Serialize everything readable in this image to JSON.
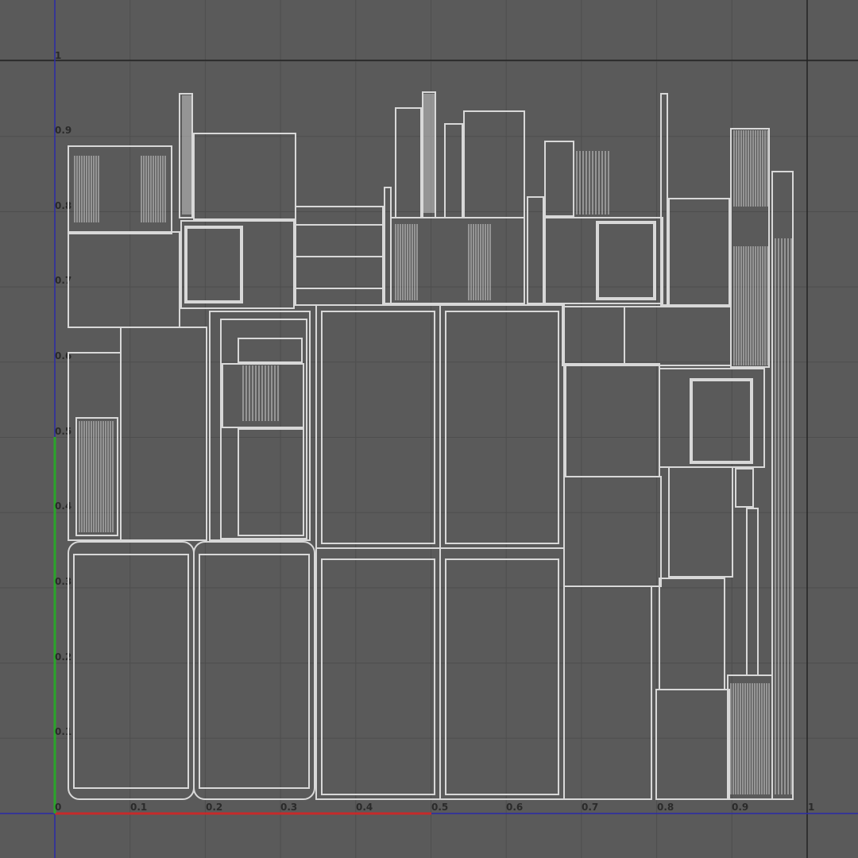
{
  "editor": {
    "type": "uv-texture-editor",
    "background": "#5a5a5a",
    "grid_color": "#4e4e4e",
    "border_color": "#222222",
    "wire_color": "#d8d8d8",
    "u_axis_color": "#c62a2a",
    "v_axis_color": "#2aa52a",
    "origin_axis_color": "#2a2aa8"
  },
  "axis": {
    "u_ticks": [
      "0",
      "0.1",
      "0.2",
      "0.3",
      "0.4",
      "0.5",
      "0.6",
      "0.7",
      "0.8",
      "0.9",
      "1"
    ],
    "v_ticks": [
      "0.1",
      "0.2",
      "0.3",
      "0.4",
      "0.5",
      "0.6",
      "0.7",
      "0.8",
      "0.9",
      "1"
    ]
  }
}
